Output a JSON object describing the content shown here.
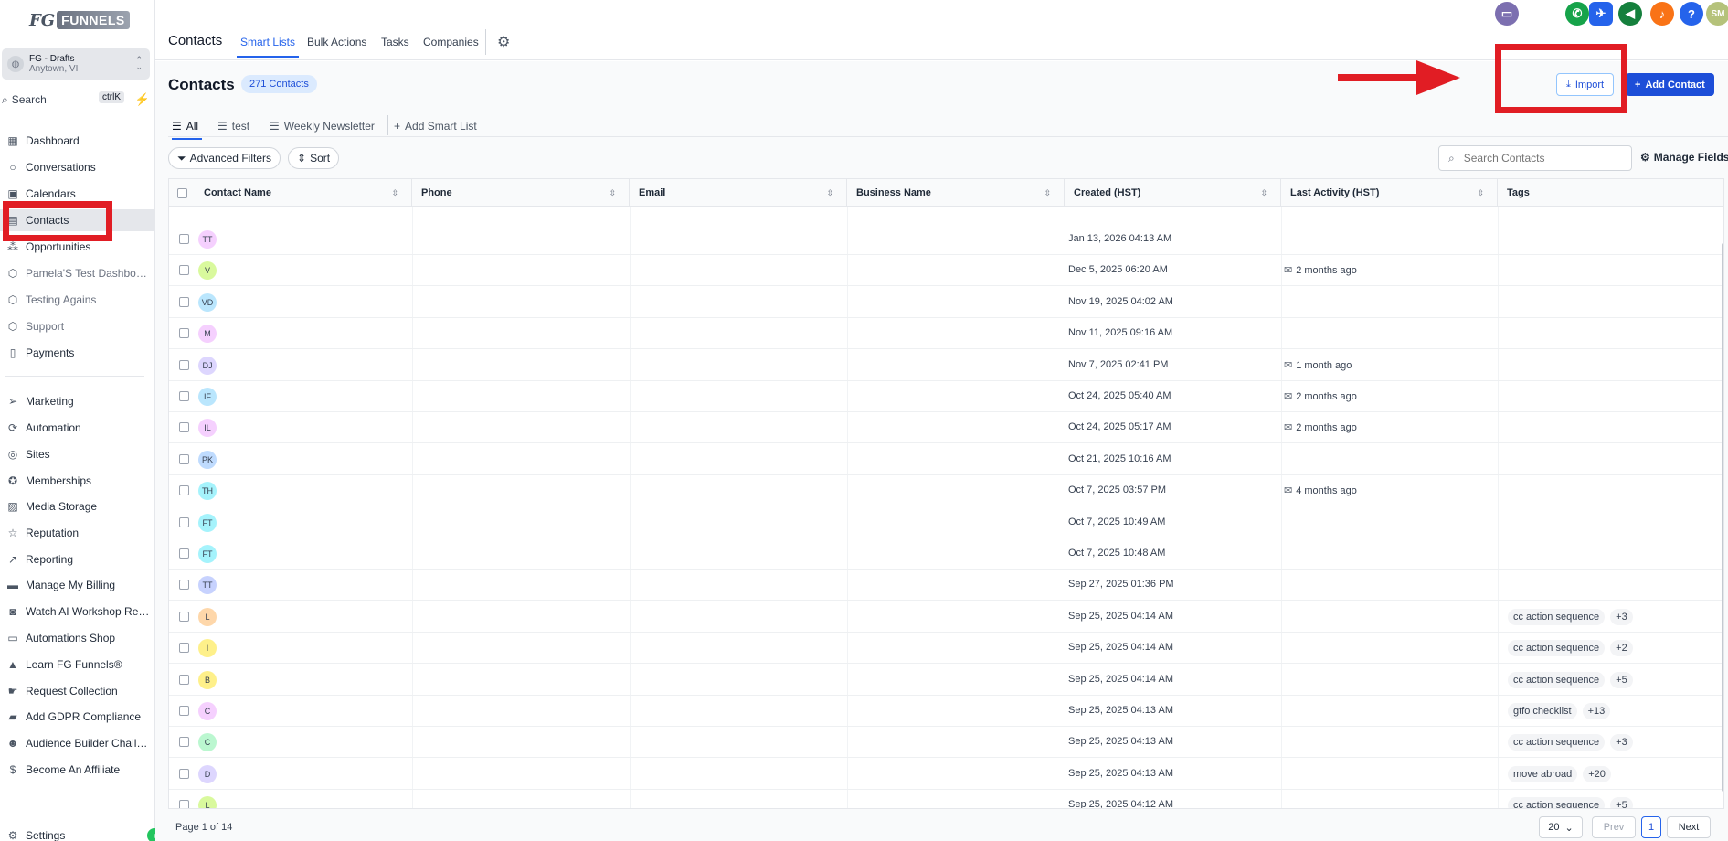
{
  "brand": {
    "logo_prefix": "FG",
    "logo_word": "FUNNELS"
  },
  "account": {
    "name": "FG - Drafts",
    "location": "Anytown, VI"
  },
  "search": {
    "label": "Search",
    "shortcut": "ctrlK"
  },
  "sidebar": {
    "items": [
      {
        "label": "Dashboard",
        "icon": "dashboard-icon",
        "glyph": "▦"
      },
      {
        "label": "Conversations",
        "icon": "chat-icon",
        "glyph": "○"
      },
      {
        "label": "Calendars",
        "icon": "calendar-icon",
        "glyph": "▣"
      },
      {
        "label": "Contacts",
        "icon": "contact-card-icon",
        "glyph": "▤"
      },
      {
        "label": "Opportunities",
        "icon": "opportunities-icon",
        "glyph": "⁂"
      },
      {
        "label": "Pamela'S Test Dashboard...",
        "icon": "cube-icon",
        "glyph": "⬡"
      },
      {
        "label": "Testing Agains",
        "icon": "cube-icon",
        "glyph": "⬡"
      },
      {
        "label": "Support",
        "icon": "cube-icon",
        "glyph": "⬡"
      },
      {
        "label": "Payments",
        "icon": "receipt-icon",
        "glyph": "▯"
      },
      {
        "label": "Marketing",
        "icon": "send-icon",
        "glyph": "➢"
      },
      {
        "label": "Automation",
        "icon": "automation-icon",
        "glyph": "⟳"
      },
      {
        "label": "Sites",
        "icon": "globe-icon",
        "glyph": "◎"
      },
      {
        "label": "Memberships",
        "icon": "award-icon",
        "glyph": "✪"
      },
      {
        "label": "Media Storage",
        "icon": "image-icon",
        "glyph": "▨"
      },
      {
        "label": "Reputation",
        "icon": "star-icon",
        "glyph": "☆"
      },
      {
        "label": "Reporting",
        "icon": "trend-icon",
        "glyph": "↗"
      },
      {
        "label": "Manage My Billing",
        "icon": "billing-icon",
        "glyph": "▬"
      },
      {
        "label": "Watch AI Workshop Repl...",
        "icon": "robot-icon",
        "glyph": "◙"
      },
      {
        "label": "Automations Shop",
        "icon": "cart-icon",
        "glyph": "▭"
      },
      {
        "label": "Learn FG Funnels®",
        "icon": "graduation-cap-icon",
        "glyph": "▲"
      },
      {
        "label": "Request Collection",
        "icon": "pointer-icon",
        "glyph": "☛"
      },
      {
        "label": "Add GDPR Compliance",
        "icon": "compliance-icon",
        "glyph": "▰"
      },
      {
        "label": "Audience Builder Challe...",
        "icon": "people-icon",
        "glyph": "☻"
      },
      {
        "label": "Become An Affiliate",
        "icon": "dollar-icon",
        "glyph": "$"
      }
    ],
    "settings": "Settings"
  },
  "header": {
    "title": "Contacts",
    "tabs": [
      "Smart Lists",
      "Bulk Actions",
      "Tasks",
      "Companies"
    ]
  },
  "main": {
    "title": "Contacts",
    "count": "271 Contacts",
    "import_label": "Import",
    "add_label": "Add Contact",
    "smart_tabs": [
      "All",
      "test",
      "Weekly Newsletter"
    ],
    "add_smart_list": "Add Smart List",
    "advanced_filters": "Advanced Filters",
    "sort": "Sort",
    "search_placeholder": "Search Contacts",
    "manage_fields": "Manage Fields"
  },
  "table": {
    "columns": [
      "Contact Name",
      "Phone",
      "Email",
      "Business Name",
      "Created (HST)",
      "Last Activity (HST)",
      "Tags"
    ],
    "rows": [
      {
        "initials": "TT",
        "color": "#f5d0fe",
        "created": "Jan 13, 2026 04:13 AM",
        "activity": "",
        "tags": []
      },
      {
        "initials": "V",
        "color": "#d9f99d",
        "created": "Dec 5, 2025 06:20 AM",
        "activity": "2 months ago",
        "tags": []
      },
      {
        "initials": "VD",
        "color": "#bae6fd",
        "created": "Nov 19, 2025 04:02 AM",
        "activity": "",
        "tags": []
      },
      {
        "initials": "M",
        "color": "#f5d0fe",
        "created": "Nov 11, 2025 09:16 AM",
        "activity": "",
        "tags": []
      },
      {
        "initials": "DJ",
        "color": "#ddd6fe",
        "created": "Nov 7, 2025 02:41 PM",
        "activity": "1 month ago",
        "tags": []
      },
      {
        "initials": "IF",
        "color": "#bae6fd",
        "created": "Oct 24, 2025 05:40 AM",
        "activity": "2 months ago",
        "tags": []
      },
      {
        "initials": "IL",
        "color": "#f5d0fe",
        "created": "Oct 24, 2025 05:17 AM",
        "activity": "2 months ago",
        "tags": []
      },
      {
        "initials": "PK",
        "color": "#bfdbfe",
        "created": "Oct 21, 2025 10:16 AM",
        "activity": "",
        "tags": []
      },
      {
        "initials": "TH",
        "color": "#a5f3fc",
        "created": "Oct 7, 2025 03:57 PM",
        "activity": "4 months ago",
        "tags": []
      },
      {
        "initials": "FT",
        "color": "#a5f3fc",
        "created": "Oct 7, 2025 10:49 AM",
        "activity": "",
        "tags": []
      },
      {
        "initials": "FT",
        "color": "#a5f3fc",
        "created": "Oct 7, 2025 10:48 AM",
        "activity": "",
        "tags": []
      },
      {
        "initials": "TT",
        "color": "#c7d2fe",
        "created": "Sep 27, 2025 01:36 PM",
        "activity": "",
        "tags": []
      },
      {
        "initials": "L",
        "color": "#fed7aa",
        "created": "Sep 25, 2025 04:14 AM",
        "activity": "",
        "tags": [
          "cc action sequence",
          "+3"
        ]
      },
      {
        "initials": "I",
        "color": "#fef08a",
        "created": "Sep 25, 2025 04:14 AM",
        "activity": "",
        "tags": [
          "cc action sequence",
          "+2"
        ]
      },
      {
        "initials": "B",
        "color": "#fef08a",
        "created": "Sep 25, 2025 04:14 AM",
        "activity": "",
        "tags": [
          "cc action sequence",
          "+5"
        ]
      },
      {
        "initials": "C",
        "color": "#f5d0fe",
        "created": "Sep 25, 2025 04:13 AM",
        "activity": "",
        "tags": [
          "gtfo checklist",
          "+13"
        ]
      },
      {
        "initials": "C",
        "color": "#bbf7d0",
        "created": "Sep 25, 2025 04:13 AM",
        "activity": "",
        "tags": [
          "cc action sequence",
          "+3"
        ]
      },
      {
        "initials": "D",
        "color": "#ddd6fe",
        "created": "Sep 25, 2025 04:13 AM",
        "activity": "",
        "tags": [
          "move abroad",
          "+20"
        ]
      },
      {
        "initials": "L",
        "color": "#d9f99d",
        "created": "Sep 25, 2025 04:12 AM",
        "activity": "",
        "tags": [
          "cc action sequence",
          "+5"
        ]
      }
    ]
  },
  "footer": {
    "page_info": "Page 1 of 14",
    "page_size": "20",
    "prev": "Prev",
    "current_page": "1",
    "next": "Next"
  },
  "top_icons": [
    {
      "name": "chat-bubble-icon",
      "color": "#7c6fb0",
      "glyph": "▭"
    },
    {
      "name": "phone-icon",
      "color": "#16a34a",
      "glyph": "✆"
    },
    {
      "name": "rocket-icon",
      "color": "#2563eb",
      "glyph": "✈"
    },
    {
      "name": "megaphone-icon",
      "color": "#15803d",
      "glyph": "◀"
    },
    {
      "name": "bell-icon",
      "color": "#f97316",
      "glyph": "♪"
    },
    {
      "name": "help-icon",
      "color": "#2563eb",
      "glyph": "?"
    },
    {
      "name": "user-avatar",
      "color": "#b5c27a",
      "glyph": "SM"
    }
  ],
  "colors": {
    "accent": "#2563eb",
    "annotation": "#e11d24"
  }
}
